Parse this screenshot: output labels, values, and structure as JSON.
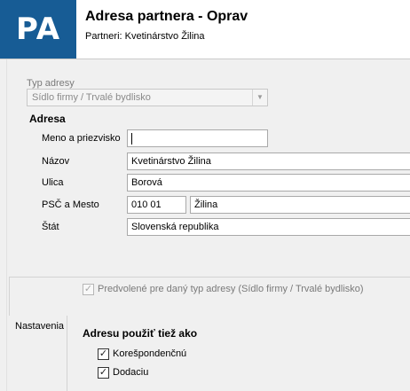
{
  "header": {
    "logo_text": "PA",
    "title": "Adresa partnera - Oprav",
    "subtitle": "Partneri: Kvetinárstvo Žilina",
    "logo_color": "#175c95"
  },
  "type_field": {
    "label": "Typ adresy",
    "value": "Sídlo firmy / Trvalé bydlisko"
  },
  "address": {
    "section_title": "Adresa",
    "fields": [
      {
        "label": "Meno a priezvisko",
        "value": ""
      },
      {
        "label": "Názov",
        "value": "Kvetinárstvo Žilina"
      },
      {
        "label": "Ulica",
        "value": "Borová"
      },
      {
        "label": "PSČ a Mesto",
        "value": "010 01",
        "value2": "Žilina"
      },
      {
        "label": "Štát",
        "value": "Slovenská republika"
      }
    ]
  },
  "settings": {
    "group_label": "Nastavenia",
    "default_checkbox": {
      "label": "Predvolené pre daný typ adresy (Sídlo firmy / Trvalé bydlisko)",
      "checked": true,
      "enabled": false
    },
    "use_as_title": "Adresu použiť tiež ako",
    "options": [
      {
        "label": "Korešpondenčnú",
        "checked": true
      },
      {
        "label": "Dodaciu",
        "checked": true
      }
    ]
  }
}
